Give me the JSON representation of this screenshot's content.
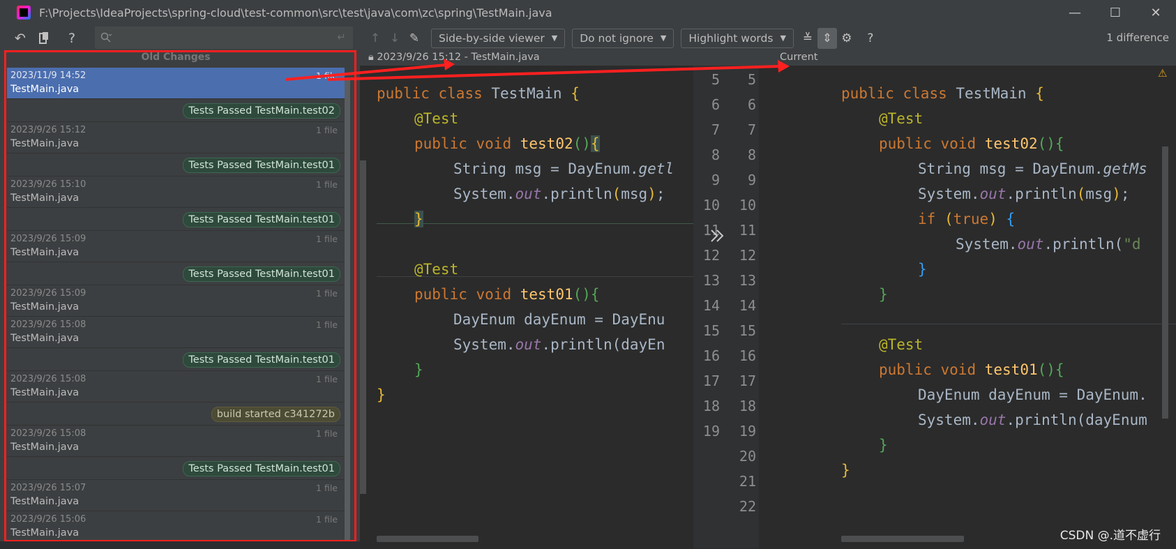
{
  "window": {
    "title": "F:\\Projects\\IdeaProjects\\spring-cloud\\test-common\\src\\test\\java\\com\\zc\\spring\\TestMain.java",
    "min_icon": "minimize-icon",
    "max_icon": "maximize-icon",
    "close_icon": "close-icon",
    "min_glyph": "—",
    "max_glyph": "☐",
    "close_glyph": "✕"
  },
  "left_panel": {
    "header": "Old Changes",
    "revisions": [
      {
        "date": "2023/11/9 14:52",
        "files": "1 file",
        "name": "TestMain.java",
        "label": "Tests Passed TestMain.test02",
        "label_type": "test"
      },
      {
        "date": "2023/9/26 15:12",
        "files": "1 file",
        "name": "TestMain.java",
        "label": "Tests Passed TestMain.test01",
        "label_type": "test"
      },
      {
        "date": "2023/9/26 15:10",
        "files": "1 file",
        "name": "TestMain.java",
        "label": "Tests Passed TestMain.test01",
        "label_type": "test"
      },
      {
        "date": "2023/9/26 15:09",
        "files": "1 file",
        "name": "TestMain.java",
        "label": "Tests Passed TestMain.test01",
        "label_type": "test"
      },
      {
        "date": "2023/9/26 15:09",
        "files": "1 file",
        "name": "TestMain.java",
        "label": "",
        "label_type": ""
      },
      {
        "date": "2023/9/26 15:08",
        "files": "1 file",
        "name": "TestMain.java",
        "label": "Tests Passed TestMain.test01",
        "label_type": "test"
      },
      {
        "date": "2023/9/26 15:08",
        "files": "1 file",
        "name": "TestMain.java",
        "label": "build started c341272b",
        "label_type": "build"
      },
      {
        "date": "2023/9/26 15:08",
        "files": "1 file",
        "name": "TestMain.java",
        "label": "Tests Passed TestMain.test01",
        "label_type": "test"
      },
      {
        "date": "2023/9/26 15:07",
        "files": "1 file",
        "name": "TestMain.java",
        "label": "",
        "label_type": ""
      },
      {
        "date": "2023/9/26 15:06",
        "files": "1 file",
        "name": "TestMain.java",
        "label": "",
        "label_type": ""
      }
    ]
  },
  "toolbar": {
    "viewer": "Side-by-side viewer",
    "ignore": "Do not ignore",
    "highlight": "Highlight words",
    "diff_count": "1 difference",
    "help": "?"
  },
  "left_editor": {
    "header": "2023/9/26 15:12 - TestMain.java",
    "lines": [
      "5",
      "6",
      "7",
      "8",
      "9",
      "10",
      "11",
      "12",
      "13",
      "14",
      "15",
      "16",
      "17",
      "18",
      "19"
    ]
  },
  "right_editor": {
    "header": "Current",
    "lines": [
      "5",
      "6",
      "7",
      "8",
      "9",
      "10",
      "11",
      "12",
      "13",
      "14",
      "15",
      "16",
      "17",
      "18",
      "19",
      "20",
      "21",
      "22"
    ]
  },
  "code": {
    "public": "public",
    "class": "class",
    "classname": "TestMain",
    "lbrace": "{",
    "rbrace": "}",
    "test_ann": "@Test",
    "void": "void",
    "test02": "test02",
    "test01": "test01",
    "parens": "()",
    "string_msg": "String msg = DayEnum.",
    "getl": "getl",
    "getms": "getMs",
    "system": "System.",
    "out": "out",
    "println_msg": ".println",
    "msg_arg": "(msg);",
    "if": "if",
    "true": "true",
    "paren_true_open": "(",
    "paren_true_close": ")",
    "println_d": ".println(",
    "str_d": "\"d",
    "dayenum_left": "DayEnum dayEnum = DayEnu",
    "dayenum_right": "DayEnum dayEnum = DayEnum.",
    "println_dayen": ".println(",
    "dayen_l": "dayEn",
    "dayen_r": "dayEnum"
  },
  "watermark": "CSDN @.道不虚行"
}
